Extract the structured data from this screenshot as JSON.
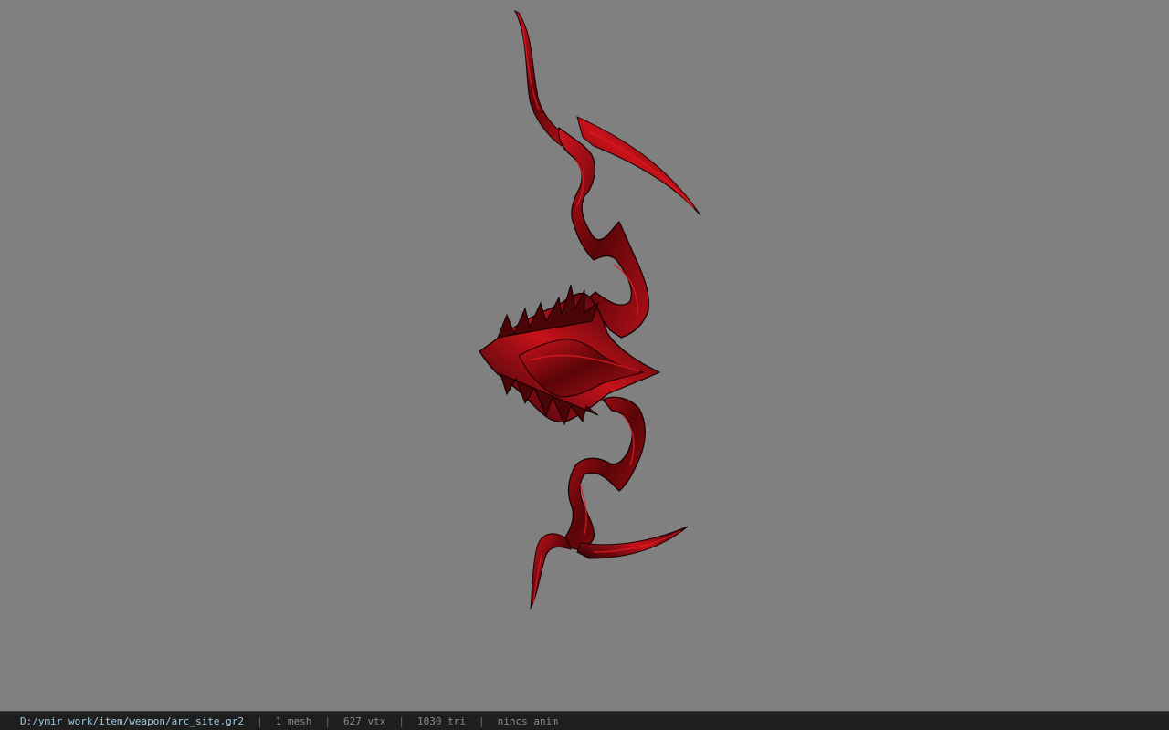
{
  "viewport": {
    "background": "#808080",
    "model": {
      "base_color": "#1a0507",
      "highlight_color": "#c0141c"
    }
  },
  "status_bar": {
    "file_path": "D:/ymir work/item/weapon/arc_site.gr2",
    "separator": "|",
    "mesh_count": "1 mesh",
    "vertex_count": "627 vtx",
    "triangle_count": "1030 tri",
    "animation": "nincs anim"
  }
}
